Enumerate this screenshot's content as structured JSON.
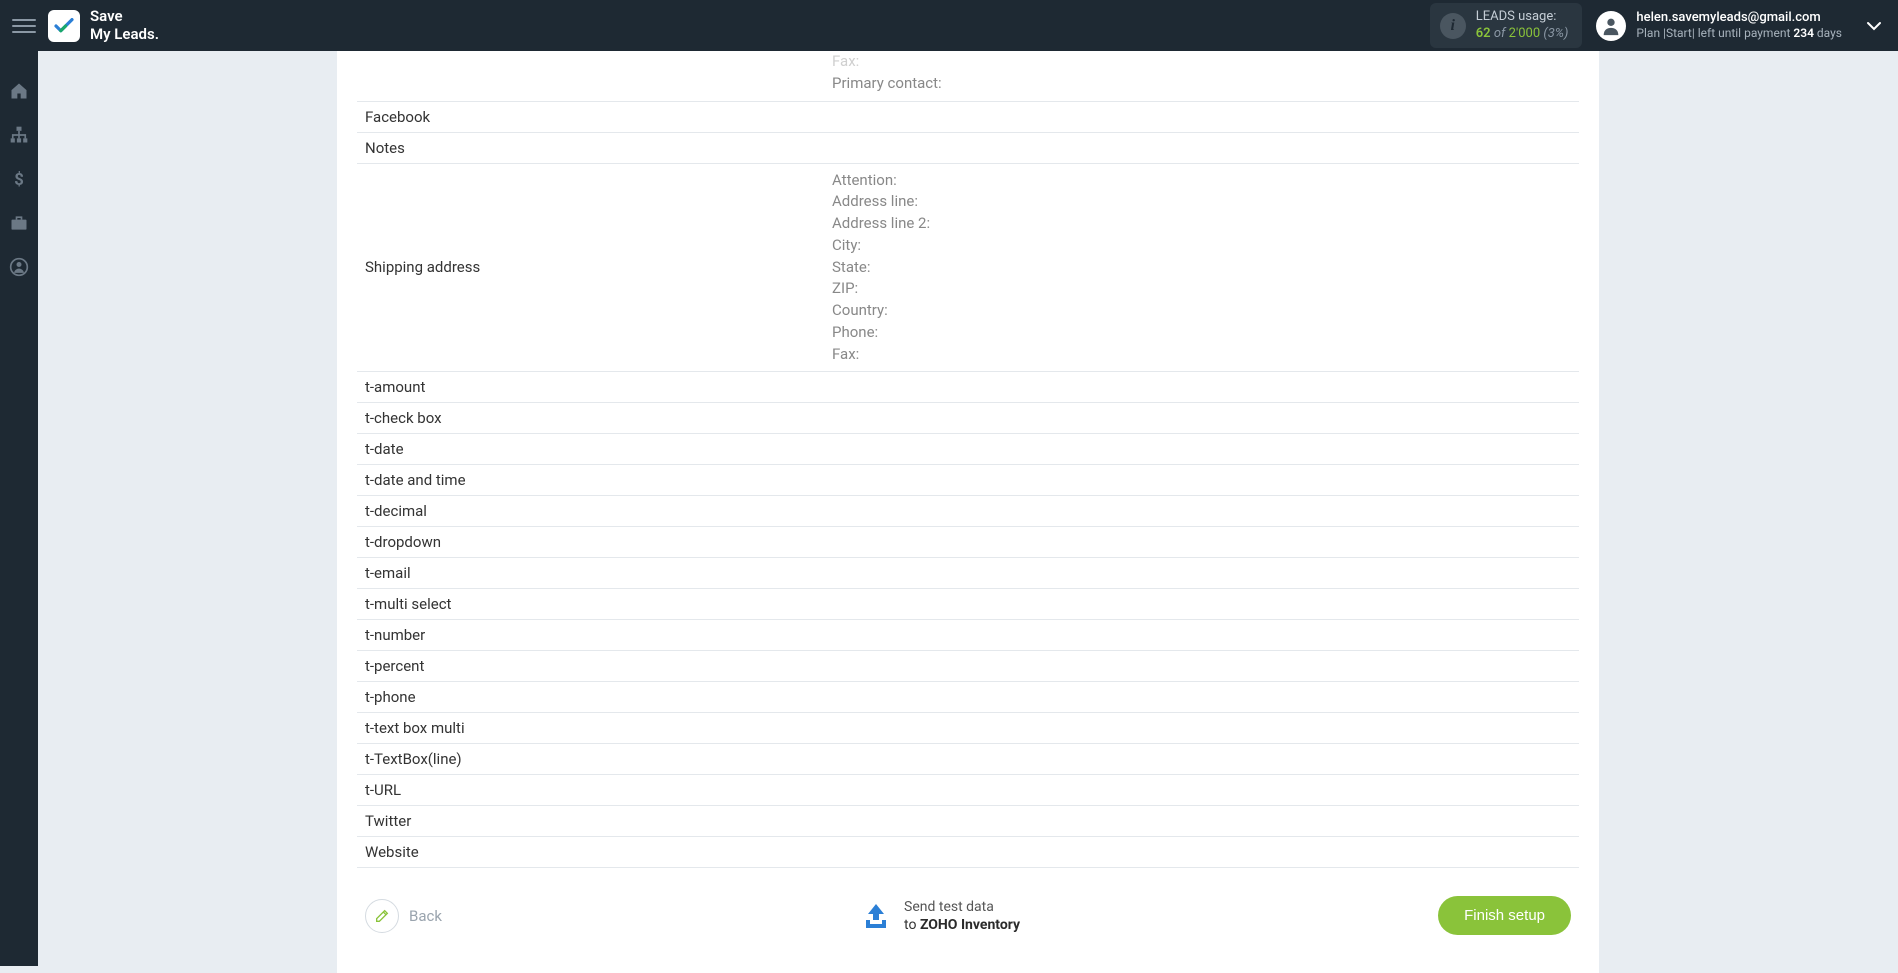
{
  "header": {
    "logo_line1": "Save",
    "logo_line2": "My Leads.",
    "leads": {
      "title": "LEADS usage:",
      "used": "62",
      "of": "of",
      "total": "2'000",
      "pct": "(3%)"
    },
    "user": {
      "email": "helen.savemyleads@gmail.com",
      "plan_prefix": "Plan |Start| left until payment ",
      "days": "234",
      "days_suffix": " days"
    }
  },
  "fields_partial_top": {
    "fax": "Fax:",
    "primary_contact": "Primary contact:"
  },
  "rows_simple_top": [
    "Facebook",
    "Notes"
  ],
  "shipping": {
    "label": "Shipping address",
    "lines": [
      "Attention:",
      "Address line:",
      "Address line 2:",
      "City:",
      "State:",
      "ZIP:",
      "Country:",
      "Phone:",
      "Fax:"
    ]
  },
  "rows_simple": [
    "t-amount",
    "t-check box",
    "t-date",
    "t-date and time",
    "t-decimal",
    "t-dropdown",
    "t-email",
    "t-multi select",
    "t-number",
    "t-percent",
    "t-phone",
    "t-text box multi",
    "t-TextBox(line)",
    "t-URL",
    "Twitter",
    "Website"
  ],
  "footer": {
    "back": "Back",
    "send1": "Send test data",
    "send2_prefix": "to ",
    "send2_bold": "ZOHO Inventory",
    "finish": "Finish setup"
  }
}
